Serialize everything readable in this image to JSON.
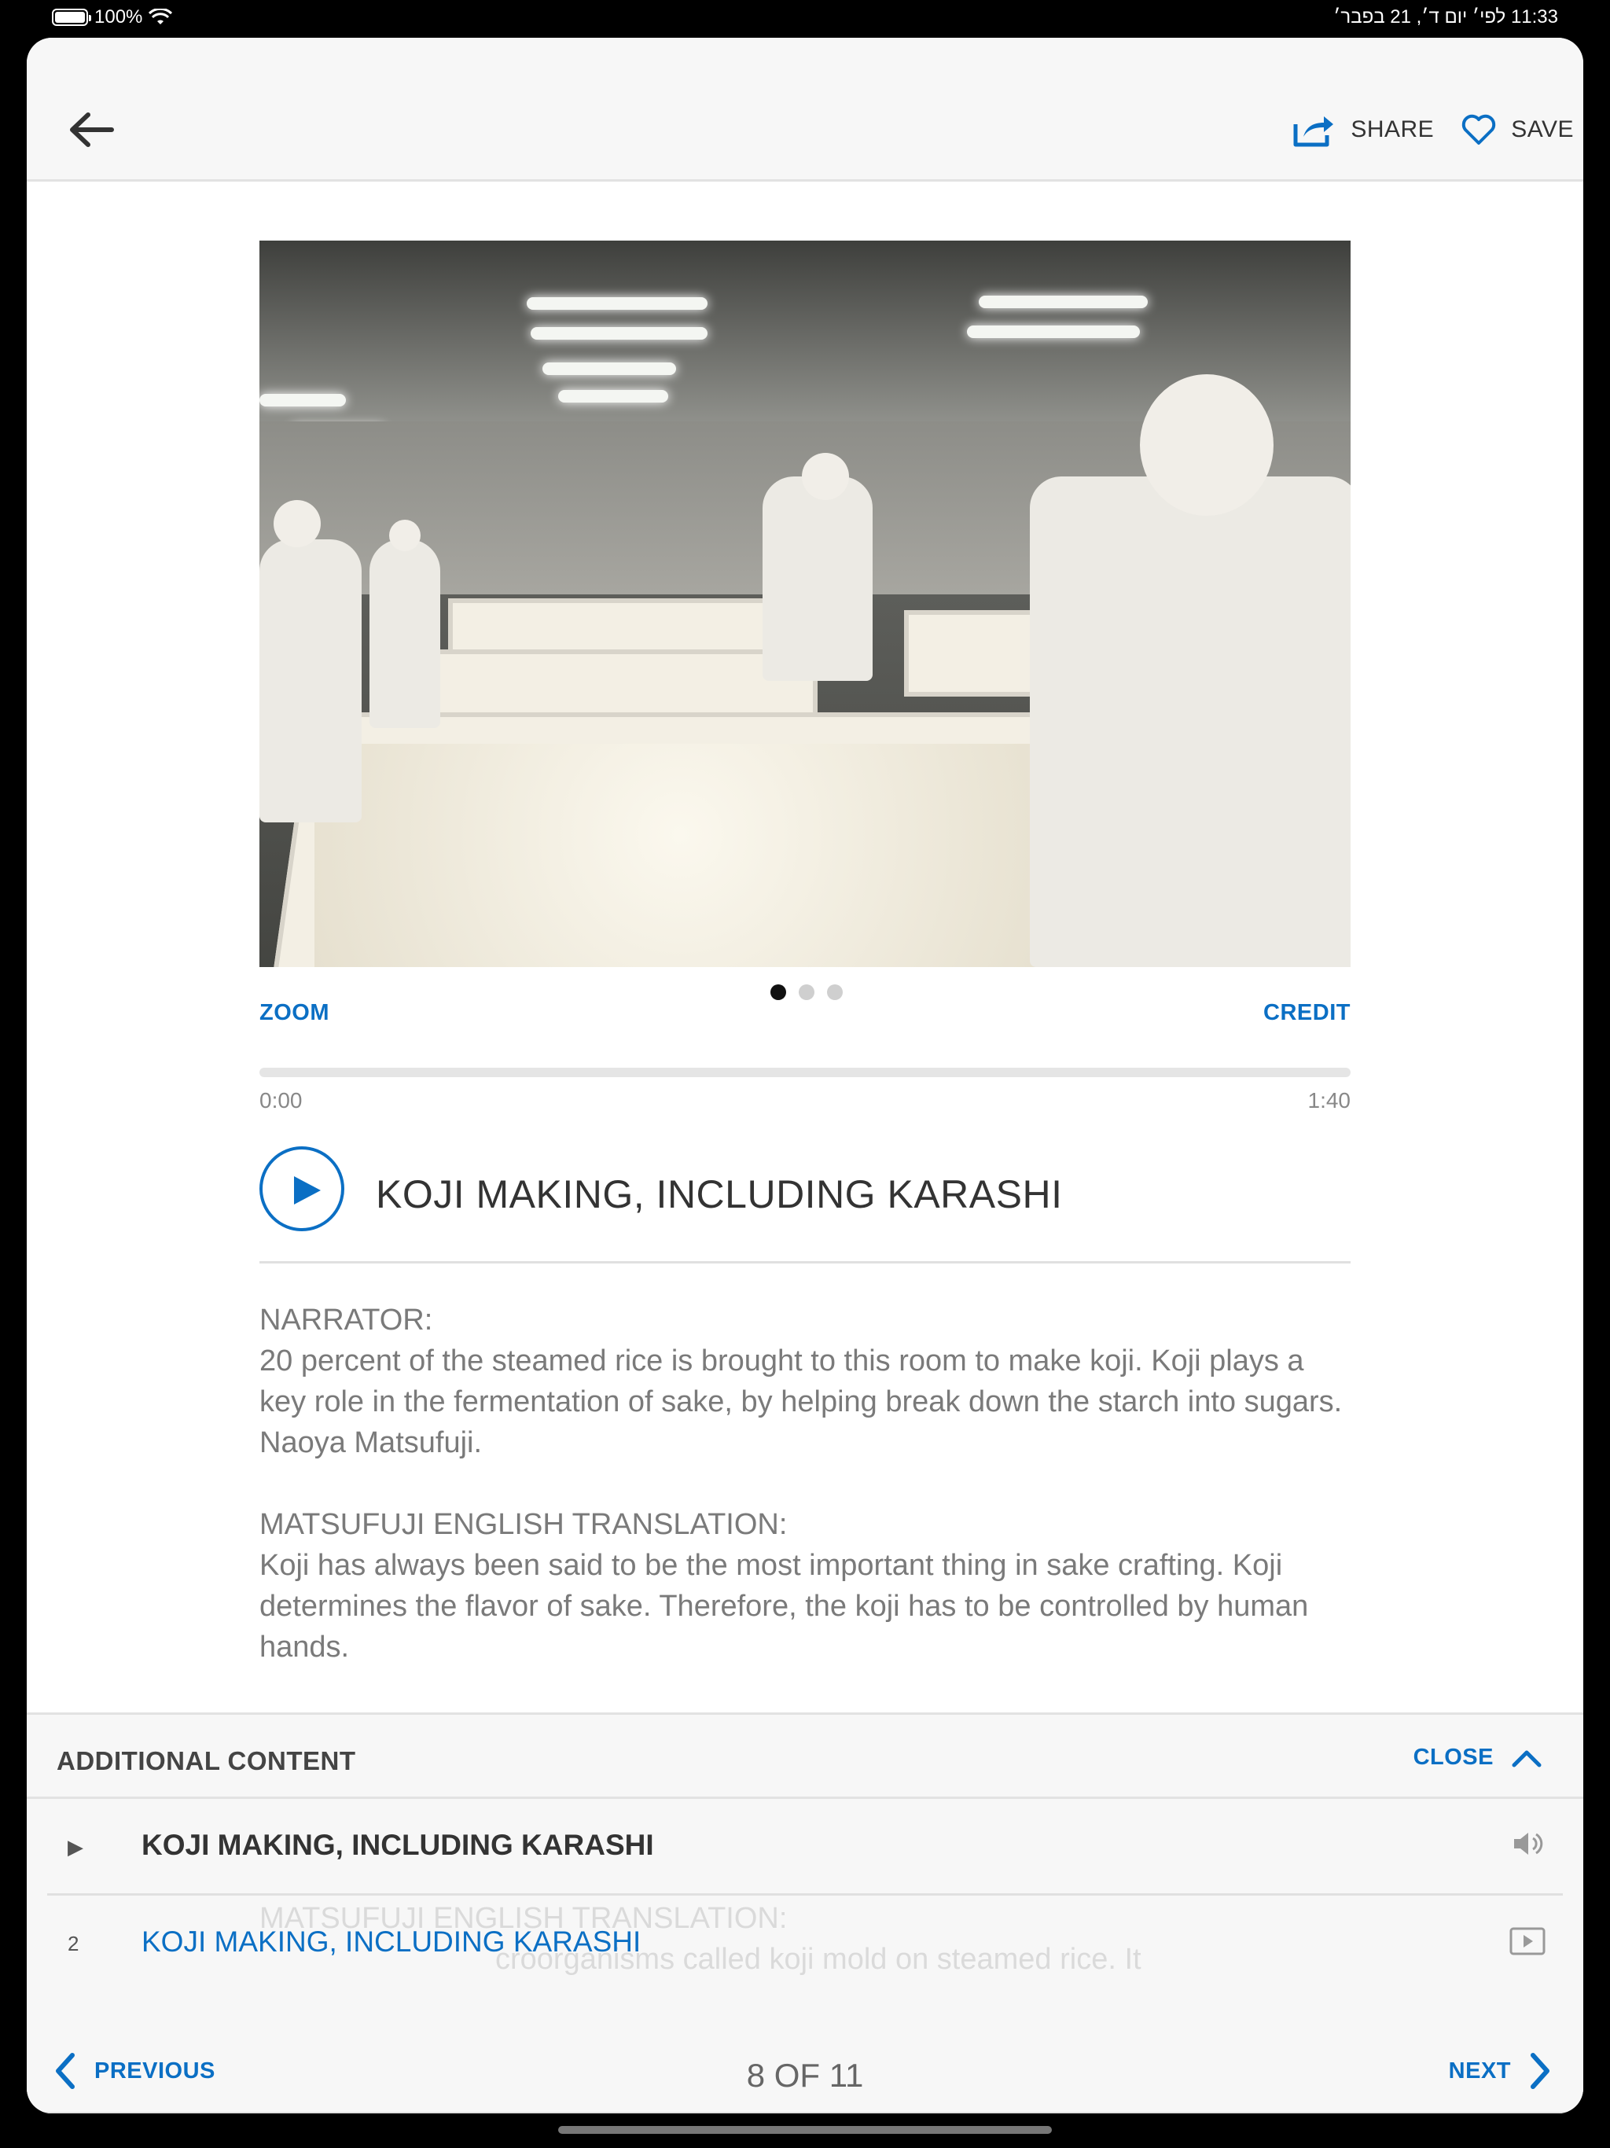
{
  "status_bar": {
    "battery": "100%",
    "time_and_date": "11:33 לפי׳  יום ד׳, 21 בפבר׳"
  },
  "nav": {
    "share_label": "SHARE",
    "save_label": "SAVE"
  },
  "media": {
    "zoom_label": "ZOOM",
    "credit_label": "CREDIT",
    "slide_count": 3,
    "active_slide": 1
  },
  "audio": {
    "current_time": "0:00",
    "duration": "1:40",
    "progress": 0
  },
  "track": {
    "title": "KOJI MAKING, INCLUDING KARASHI"
  },
  "transcript": {
    "p1_speaker": "NARRATOR:",
    "p1_text": "20 percent of the steamed rice is brought to this room to make koji. Koji plays a key role in the fermentation of sake, by helping break down the starch into sugars. Naoya Matsufuji.",
    "p2_speaker": "MATSUFUJI ENGLISH TRANSLATION:",
    "p2_text": "Koji has always been said to be the most important thing in sake crafting. Koji determines the flavor of sake. Therefore, the koji has to be controlled by human hands.",
    "ghost_line1": "MATSUFUJI ENGLISH TRANSLATION:",
    "ghost_line2": "croorganisms called koji mold on steamed rice. It"
  },
  "drawer": {
    "title": "ADDITIONAL CONTENT",
    "close_label": "CLOSE",
    "items": [
      {
        "marker": "▶",
        "label": "KOJI MAKING, INCLUDING KARASHI",
        "type_icon": "speaker-icon"
      },
      {
        "marker": "2",
        "label": "KOJI MAKING, INCLUDING KARASHI",
        "type_icon": "video-icon"
      }
    ]
  },
  "pager": {
    "previous_label": "PREVIOUS",
    "next_label": "NEXT",
    "count": "8 OF 11"
  },
  "colors": {
    "accent": "#0b6fc4",
    "text_dark": "#333333",
    "text_muted": "#7a7a7a"
  }
}
